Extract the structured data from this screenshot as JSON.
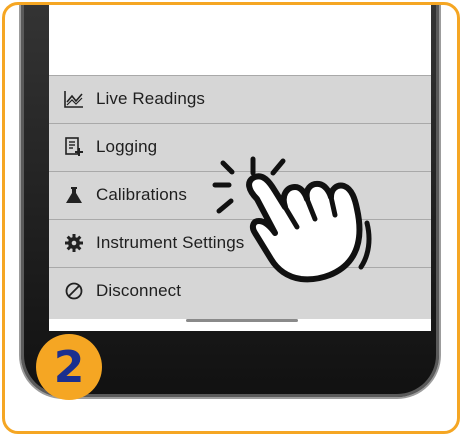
{
  "menu": {
    "items": [
      {
        "label": "Live Readings",
        "icon": "chart-line-icon"
      },
      {
        "label": "Logging",
        "icon": "log-add-icon"
      },
      {
        "label": "Calibrations",
        "icon": "flask-icon"
      },
      {
        "label": "Instrument Settings",
        "icon": "gear-icon"
      },
      {
        "label": "Disconnect",
        "icon": "disconnect-icon"
      }
    ]
  },
  "step": {
    "number": "2"
  },
  "colors": {
    "frame": "#f5a623",
    "badge": "#f5a623",
    "badge_number": "#1b2f8f",
    "menu_background": "#d6d6d6",
    "divider": "#a9a9a9"
  }
}
